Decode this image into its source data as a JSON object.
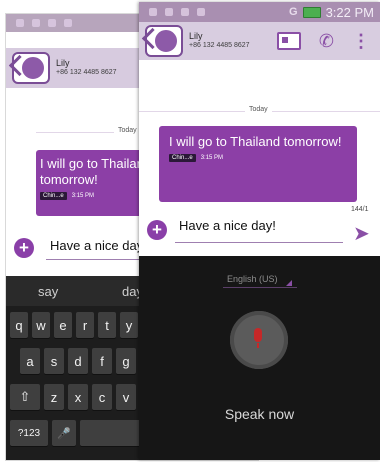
{
  "back_screen": {
    "contact": {
      "name": "Lily",
      "phone": "+86 132 4485 8627"
    },
    "date_label": "Today",
    "message": {
      "text": "I will go to Thailand tomorrow!",
      "sim": "Chin...e",
      "time": "3:15 PM"
    },
    "input_text": "Have a nice day",
    "suggestions": [
      "say",
      "day"
    ],
    "keyboard_rows": [
      [
        "q",
        "w",
        "e",
        "r",
        "t",
        "y"
      ],
      [
        "a",
        "s",
        "d",
        "f",
        "g"
      ],
      [
        "⇧",
        "z",
        "x",
        "c",
        "v"
      ],
      [
        "?123",
        "🎤",
        "",
        ",",
        "."
      ]
    ]
  },
  "front_screen": {
    "status_time": "3:22 PM",
    "status_network": "G",
    "contact": {
      "name": "Lily",
      "phone": "+86 132 4485 8627"
    },
    "date_label": "Today",
    "message": {
      "text": "I will go to Thailand tomorrow!",
      "sim": "Chin...e",
      "time": "3:15 PM"
    },
    "char_counter": "144/1",
    "input_text": "Have a nice day!",
    "voice_language": "English (US)",
    "voice_prompt": "Speak now"
  },
  "colors": {
    "accent": "#8a3fa8",
    "header_bg": "#d8cde0",
    "status_bg": "#a98fb1",
    "keyboard_bg": "#1d1d1d"
  }
}
